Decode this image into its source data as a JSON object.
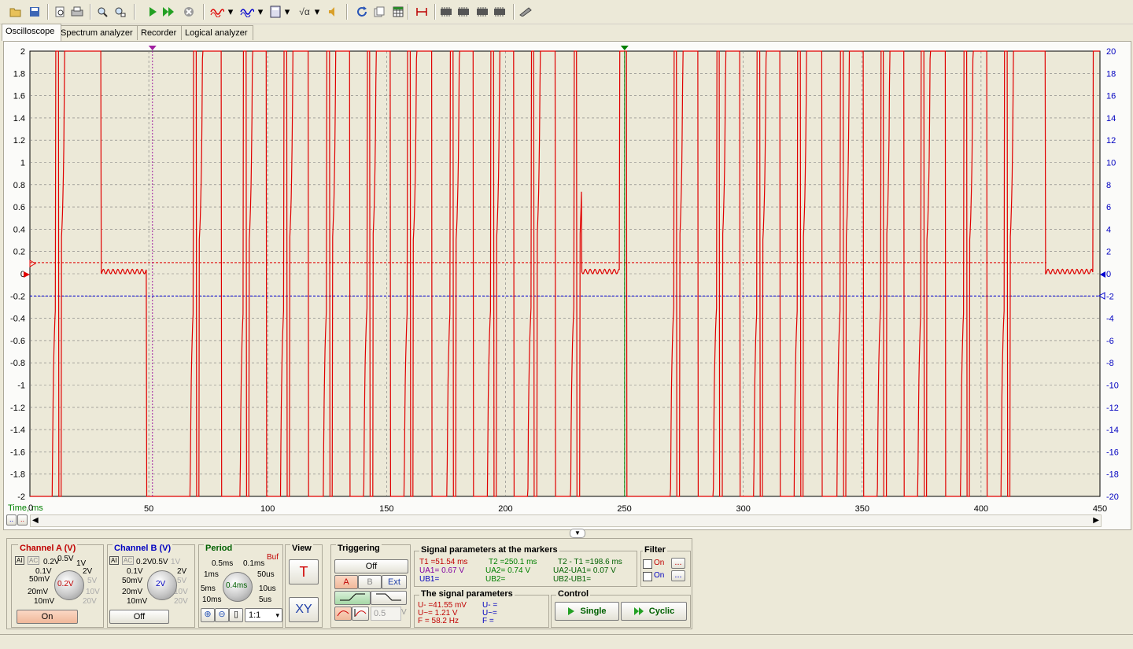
{
  "tabs": [
    {
      "label": "Oscilloscope"
    },
    {
      "label": "Spectrum analyzer"
    },
    {
      "label": "Recorder"
    },
    {
      "label": "Logical analyzer"
    }
  ],
  "toolbar": {
    "icons": [
      "open-icon",
      "save-icon",
      "print-preview-icon",
      "print-icon",
      "zoom-icon",
      "zoom-fit-icon",
      "play-icon",
      "play-continuous-icon",
      "stop-icon",
      "signal-a-icon",
      "signal-b-icon",
      "calculator-icon",
      "sqrt-icon",
      "audio-icon",
      "refresh-icon",
      "copy-icon",
      "table-icon",
      "measure-icon",
      "chip1-icon",
      "chip2-icon",
      "chip3-icon",
      "chip4-icon",
      "pen-icon"
    ]
  },
  "plot": {
    "left_ticks": [
      "2",
      "1.8",
      "1.6",
      "1.4",
      "1.2",
      "1",
      "0.8",
      "0.6",
      "0.4",
      "0.2",
      "0",
      "-0.2",
      "-0.4",
      "-0.6",
      "-0.8",
      "-1",
      "-1.2",
      "-1.4",
      "-1.6",
      "-1.8",
      "-2"
    ],
    "right_ticks": [
      "20",
      "18",
      "16",
      "14",
      "12",
      "10",
      "8",
      "6",
      "4",
      "2",
      "0",
      "-2",
      "-4",
      "-6",
      "-8",
      "-10",
      "-12",
      "-14",
      "-16",
      "-18",
      "-20"
    ],
    "x_ticks": [
      "50",
      "100",
      "150",
      "200",
      "250",
      "300",
      "350",
      "400",
      "450"
    ],
    "time_label": "Time, ms",
    "origin_label": "0"
  },
  "chart_data": {
    "type": "line",
    "x_range": [
      0,
      450
    ],
    "ylim_left": [
      -2,
      2
    ],
    "ylim_right": [
      -20,
      20
    ],
    "series": [
      {
        "name": "Channel A",
        "color": "#e00000"
      },
      {
        "name": "Channel B",
        "color": "#0000d0"
      }
    ],
    "trigger_level_a": 0.1,
    "channel_b_level": -0.2,
    "marker_t1": 51.54,
    "marker_t2": 250.1,
    "pulse_centers": [
      12,
      70,
      91,
      108,
      126,
      143,
      160,
      178,
      195,
      212,
      230,
      272,
      290,
      307,
      324,
      342,
      359,
      376,
      394,
      411
    ],
    "quiet_ranges": [
      [
        30,
        49
      ],
      [
        232,
        248
      ],
      [
        427,
        447
      ]
    ]
  },
  "channel_a": {
    "title": "Channel A (V)",
    "ranges": [
      "10mV",
      "20mV",
      "50mV",
      "0.1V",
      "0.2V",
      "0.5V",
      "1V",
      "2V",
      "5V",
      "10V",
      "20V"
    ],
    "value": "0.2V",
    "button": "On",
    "mode_icons": [
      "AI",
      "AC"
    ]
  },
  "channel_b": {
    "title": "Channel B (V)",
    "ranges": [
      "10mV",
      "20mV",
      "50mV",
      "0.1V",
      "0.2V",
      "0.5V",
      "1V",
      "2V",
      "5V",
      "10V",
      "20V"
    ],
    "value": "2V",
    "button": "Off",
    "mode_icons": [
      "AI",
      "AC"
    ]
  },
  "period": {
    "title": "Period",
    "buf": "Buf",
    "ranges": [
      "10ms",
      "5ms",
      "1ms",
      "0.5ms",
      "0.1ms",
      "50us",
      "10us",
      "5us"
    ],
    "value": "0.4ms",
    "ratio": "1:1"
  },
  "view": {
    "title": "View",
    "t_button": "T",
    "xy_button": "XY"
  },
  "triggering": {
    "title": "Triggering",
    "mode": "Off",
    "sources": [
      "A",
      "B",
      "Ext"
    ],
    "level": "0.5",
    "unit": "V"
  },
  "markers": {
    "title": "Signal parameters at the markers",
    "t1": "T1 =51.54 ms",
    "ua1": "UA1= 0.67 V",
    "ub1": "UB1=",
    "t2": "T2 =250.1 ms",
    "ua2": "UA2= 0.74 V",
    "ub2": "UB2=",
    "dt": "T2 - T1 =198.6 ms",
    "dua": "UA2-UA1= 0.07 V",
    "dub": "UB2-UB1="
  },
  "signal": {
    "title": "The signal parameters",
    "u_dc_a": "U- =41.55 mV",
    "u_ac_a": "U~= 1.21 V",
    "f_a": "F  = 58.2 Hz",
    "u_dc_b": "U- =",
    "u_ac_b": "U~=",
    "f_b": "F  ="
  },
  "filter": {
    "title": "Filter",
    "on_a": "On",
    "on_b": "On",
    "more": "..."
  },
  "control": {
    "title": "Control",
    "single": "Single",
    "cyclic": "Cyclic"
  }
}
